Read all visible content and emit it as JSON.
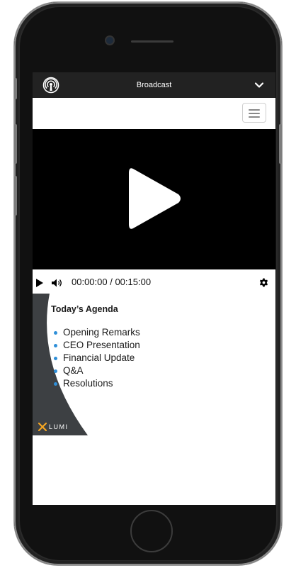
{
  "topbar": {
    "title": "Broadcast"
  },
  "player": {
    "time": "00:00:00 / 00:15:00"
  },
  "slide": {
    "title": "Today’s Agenda",
    "items": [
      "Opening Remarks",
      "CEO Presentation",
      "Financial Update",
      "Q&A",
      "Resolutions"
    ],
    "brand": "LUMI"
  },
  "colors": {
    "topbar_bg": "#222222",
    "bullet": "#2f8fd8",
    "brand_accent": "#f5a623",
    "slide_panel": "#3d4043"
  },
  "icons": {
    "broadcast": "broadcast-icon",
    "dropdown": "chevron-down-icon",
    "menu": "hamburger-menu-icon",
    "play": "play-icon",
    "volume": "volume-icon",
    "settings": "gear-icon"
  }
}
